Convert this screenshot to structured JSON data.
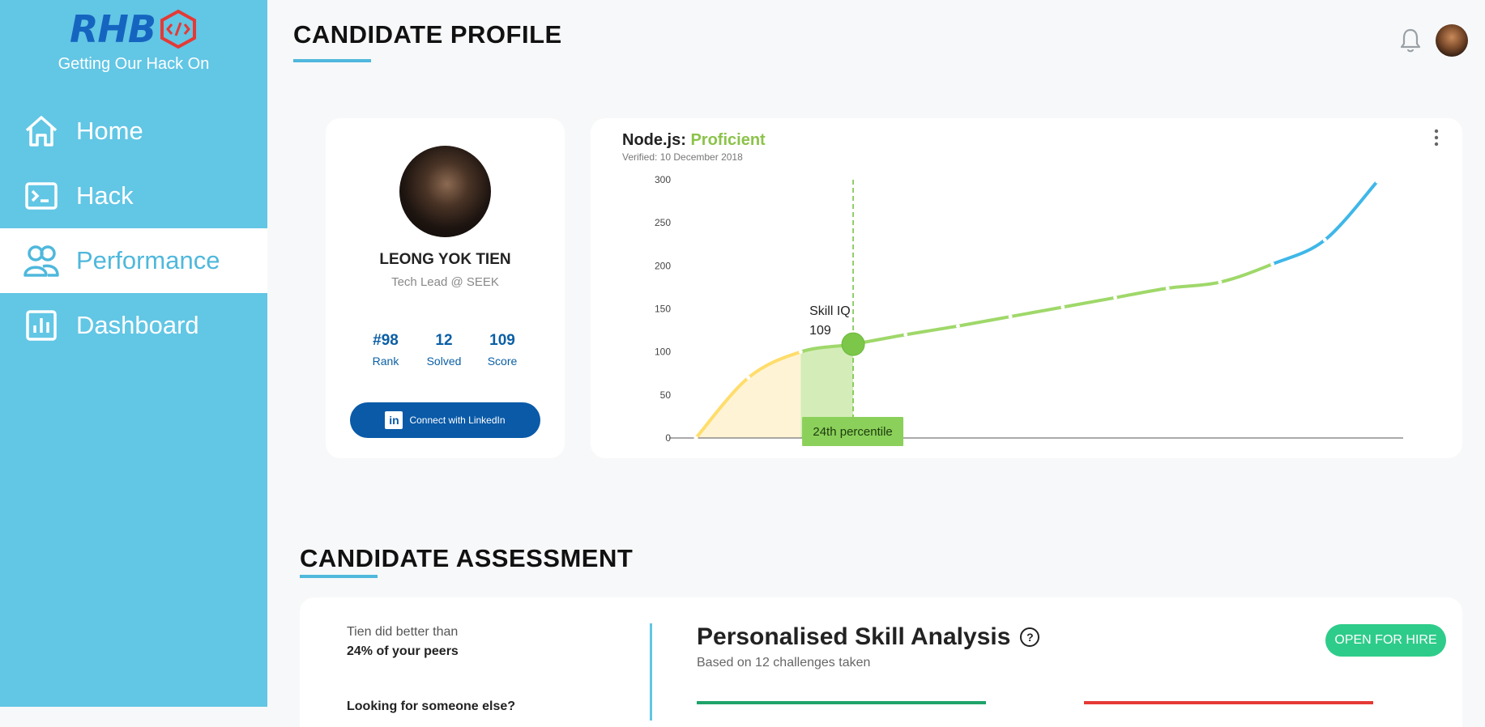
{
  "brand": {
    "logo_text": "RHB",
    "tagline": "Getting Our Hack On"
  },
  "sidebar": {
    "items": [
      {
        "label": "Home",
        "icon": "home-icon"
      },
      {
        "label": "Hack",
        "icon": "terminal-icon"
      },
      {
        "label": "Performance",
        "icon": "users-icon",
        "active": true
      },
      {
        "label": "Dashboard",
        "icon": "bar-chart-icon"
      }
    ]
  },
  "header": {
    "title": "CANDIDATE PROFILE"
  },
  "profile": {
    "name": "LEONG YOK TIEN",
    "role": "Tech Lead @ SEEK",
    "stats": [
      {
        "value": "#98",
        "label": "Rank"
      },
      {
        "value": "12",
        "label": "Solved"
      },
      {
        "value": "109",
        "label": "Score"
      }
    ],
    "linkedin_label": "Connect with LinkedIn"
  },
  "skill": {
    "name": "Node.js:",
    "level": "Proficient",
    "verified": "Verified: 10 December 2018",
    "marker_label": "Skill IQ",
    "marker_value": "109",
    "percentile_label": "24th percentile"
  },
  "chart_data": {
    "type": "line",
    "ylim": [
      0,
      300
    ],
    "yticks": [
      0,
      50,
      100,
      150,
      200,
      250,
      300
    ],
    "grid": false,
    "marker": {
      "index": 3,
      "value": 109
    },
    "series": [
      {
        "values": [
          0,
          70,
          100,
          109,
          120,
          130,
          141,
          152,
          163,
          174,
          181,
          202,
          230,
          298
        ],
        "segments": [
          {
            "from": 0,
            "to": 2,
            "color": "#ffdd6b"
          },
          {
            "from": 2,
            "to": 11,
            "color": "#9fd86a"
          },
          {
            "from": 11,
            "to": 13,
            "color": "#3fb7e8"
          }
        ]
      }
    ]
  },
  "assessment": {
    "title": "CANDIDATE ASSESSMENT",
    "peer_text": "Tien did better than",
    "peer_strong": "24% of your peers",
    "peer_more": "Looking for someone else?",
    "analysis_title": "Personalised Skill Analysis",
    "analysis_sub": "Based on 12 challenges taken",
    "hire_label": "OPEN FOR HIRE"
  },
  "colors": {
    "sidebar": "#62c6e5",
    "accent": "#4fb8dc",
    "proficient": "#8bc34a",
    "linkedin": "#0a5aa8",
    "hire": "#2ecc8a"
  }
}
